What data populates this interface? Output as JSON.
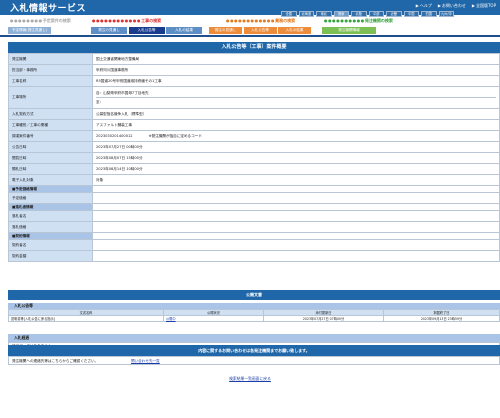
{
  "header": {
    "title": "入札情報サービス",
    "links": [
      {
        "icon": "▶",
        "label": "ヘルプ"
      },
      {
        "icon": "▶",
        "label": "お問い合わせ"
      },
      {
        "icon": "▶",
        "label": "全国版TOP"
      }
    ],
    "regions": [
      "全国",
      "北海道",
      "東北",
      "関東",
      "北陸",
      "中部",
      "近畿",
      "中国",
      "四国",
      "九州/沖"
    ]
  },
  "nav": {
    "categories": [
      {
        "label": "予定案件の検索",
        "bullets": "●●●●●●●●"
      },
      {
        "label": "工事の検索",
        "bullets": "●●●●●●●●●●●●"
      },
      {
        "label": "業務の検索",
        "bullets": "●●●●●●●●●●●●"
      },
      {
        "label": "発注機関の検索",
        "bullets": "●●●●●●●●●●"
      }
    ],
    "tabs_plan": [
      "予定情報(発注見通し)"
    ],
    "tabs_construction": [
      "発注の見通し",
      "入札公告等",
      "入札の結果"
    ],
    "tabs_service": [
      "発注の見通し",
      "入札公告等",
      "入札の結果"
    ],
    "tabs_agency": [
      "発注機関情報"
    ]
  },
  "main": {
    "title": "入札公告等（工事）案件概要",
    "rows": [
      {
        "label": "発注機関",
        "value": "国土交通省関東地方整備局"
      },
      {
        "label": "担当部・事務所",
        "value": "甲府河川国道事務所"
      },
      {
        "label": "工事名称",
        "value": "R5国道20号甲府国道維持修繕その1工事"
      },
      {
        "label": "工事場所",
        "value": "自：山梨県甲府市国母7丁目地先",
        "value2": "至："
      },
      {
        "label": "入札契約方式",
        "value": "公募型指名競争入札（標準型）"
      },
      {
        "label": "工事種別／工事の業種",
        "value": "アスファルト舗装工事"
      },
      {
        "label": "調達案件番号",
        "value": "2023030201400012",
        "value_note": "※発注機関が独自に定めるコード"
      },
      {
        "label": "公告日時",
        "value": "2023年07月27日 00時00分"
      },
      {
        "label": "閲覧日時",
        "value": "2023年08月07日 15時00分"
      },
      {
        "label": "開札日時",
        "value": "2023年08月14日 10時00分"
      },
      {
        "label": "電子入札対象",
        "value": "対象"
      }
    ],
    "section_plan": "■予定価格情報",
    "row_plan": "予定価格",
    "section_bidder": "■落札者情報",
    "rows_bidder": [
      "落札者名",
      "落札価格"
    ],
    "section_contract": "■契約情報",
    "rows_contract": [
      "契約者名",
      "契約金額"
    ]
  },
  "docs": {
    "title": "公開文書",
    "subtitle": "入札公告等",
    "columns": [
      "文書名称",
      "公開状況",
      "添付更新日",
      "掲載終了日"
    ],
    "rows": [
      {
        "name": "説明書等[入札公告に係る指示]",
        "status": "公開中",
        "updated": "2023年07月27日 07時00分",
        "end": "2023年09月13日 23時59分"
      }
    ]
  },
  "results": {
    "subtitle": "入札経過",
    "text": "該当データはありません"
  },
  "contact": {
    "bar": "内容に関するお問い合わせは各発注機関までお願い致します。",
    "label": "発注機関への連絡先等はこちらからご確認ください。",
    "link": "問い合わせ先一覧"
  },
  "back_link": "検索結果一覧画面に戻る"
}
